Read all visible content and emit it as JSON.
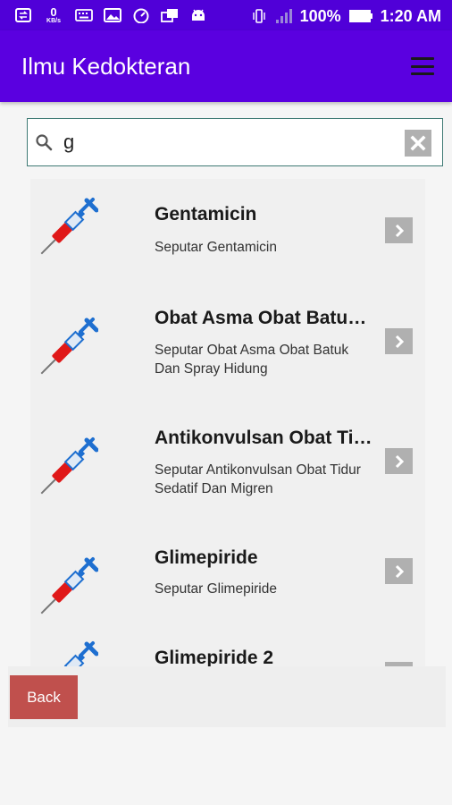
{
  "status_bar": {
    "kbs_value": "0",
    "kbs_unit": "KB/s",
    "battery": "100%",
    "time": "1:20 AM",
    "icons_left": [
      "data-transfer-icon",
      "keyboard-icon",
      "image-icon",
      "speedometer-icon",
      "screens-icon",
      "android-icon"
    ],
    "icons_right": [
      "vibrate-icon",
      "signal-icon",
      "battery-icon"
    ]
  },
  "app_bar": {
    "title": "Ilmu Kedokteran",
    "menu_icon": "hamburger-menu-icon",
    "color": "#5a00e0"
  },
  "search": {
    "value": "g",
    "placeholder": "",
    "icon": "search-icon",
    "clear_icon": "clear-icon"
  },
  "items": [
    {
      "title": "Gentamicin",
      "subtitle": "Seputar Gentamicin"
    },
    {
      "title": "Obat Asma Obat Batu…",
      "subtitle": "Seputar Obat Asma Obat Batuk Dan Spray Hidung"
    },
    {
      "title": "Antikonvulsan Obat Ti…",
      "subtitle": "Seputar Antikonvulsan Obat Tidur Sedatif Dan Migren"
    },
    {
      "title": "Glimepiride",
      "subtitle": "Seputar Glimepiride"
    },
    {
      "title": "Glimepiride 2",
      "subtitle": ""
    }
  ],
  "item_icon": "syringe-icon",
  "item_action_icon": "chevron-right-icon",
  "back_button": {
    "label": "Back",
    "color": "#c0504d"
  }
}
